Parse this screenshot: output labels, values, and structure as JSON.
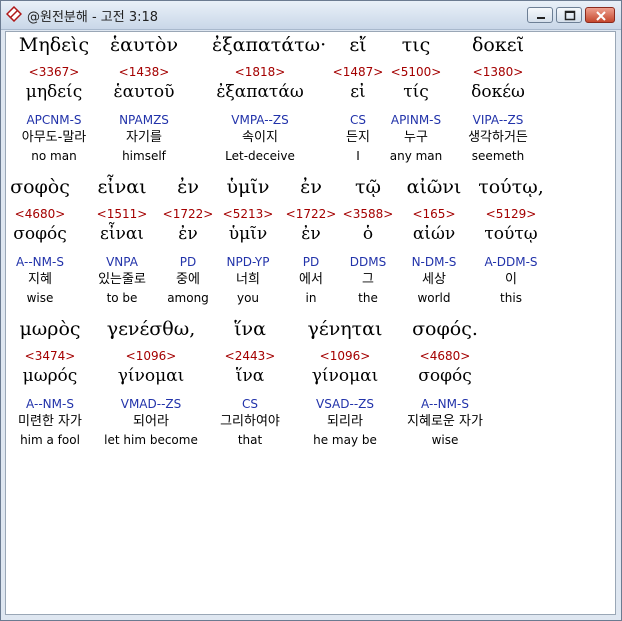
{
  "window": {
    "title": "@원전분해 - 고전 3:18",
    "icon": "app-diamond-icon",
    "buttons": [
      "minimize-icon",
      "maximize-icon",
      "close-icon"
    ],
    "colors": {
      "greek": "#000000",
      "strong": "#a40000",
      "morph": "#2233aa",
      "gloss": "#000000"
    }
  },
  "rows": [
    {
      "words": [
        {
          "greek": "Μηδεὶς",
          "strong": "<3367>",
          "lexeme": "μηδείς",
          "morph": "APCNM-S",
          "korean": "아무도-말라",
          "english": "no man"
        },
        {
          "greek": "ἑαυτὸν",
          "strong": "<1438>",
          "lexeme": "ἑαυτοῦ",
          "morph": "NPAMZS",
          "korean": "자기를",
          "english": "himself"
        },
        {
          "greek": "ἐξαπατάτω·",
          "strong": "<1818>",
          "lexeme": "ἐξαπατάω",
          "morph": "VMPA--ZS",
          "korean": "속이지",
          "english": "Let-deceive"
        },
        {
          "greek": "εἴ",
          "strong": "<1487>",
          "lexeme": "εἰ",
          "morph": "CS",
          "korean": "든지",
          "english": "I"
        },
        {
          "greek": "τις",
          "strong": "<5100>",
          "lexeme": "τίς",
          "morph": "APINM-S",
          "korean": "누구",
          "english": "any man"
        },
        {
          "greek": "δοκεῖ",
          "strong": "<1380>",
          "lexeme": "δοκέω",
          "morph": "VIPA--ZS",
          "korean": "생각하거든",
          "english": "seemeth"
        }
      ]
    },
    {
      "words": [
        {
          "greek": "σοφὸς",
          "strong": "<4680>",
          "lexeme": "σοφός",
          "morph": "A--NM-S",
          "korean": "지혜",
          "english": "wise"
        },
        {
          "greek": "εἶναι",
          "strong": "<1511>",
          "lexeme": "εἶναι",
          "morph": "VNPA",
          "korean": "있는줄로",
          "english": "to be"
        },
        {
          "greek": "ἐν",
          "strong": "<1722>",
          "lexeme": "ἐν",
          "morph": "PD",
          "korean": "중에",
          "english": "among"
        },
        {
          "greek": "ὑμῖν",
          "strong": "<5213>",
          "lexeme": "ὑμῖν",
          "morph": "NPD-YP",
          "korean": "너희",
          "english": "you"
        },
        {
          "greek": "ἐν",
          "strong": "<1722>",
          "lexeme": "ἐν",
          "morph": "PD",
          "korean": "에서",
          "english": "in"
        },
        {
          "greek": "τῷ",
          "strong": "<3588>",
          "lexeme": "ὁ",
          "morph": "DDMS",
          "korean": "그",
          "english": "the"
        },
        {
          "greek": "αἰῶνι",
          "strong": "<165>",
          "lexeme": "αἰών",
          "morph": "N-DM-S",
          "korean": "세상",
          "english": "world"
        },
        {
          "greek": "τούτῳ,",
          "strong": "<5129>",
          "lexeme": "τούτῳ",
          "morph": "A-DDM-S",
          "korean": "이",
          "english": "this"
        }
      ]
    },
    {
      "words": [
        {
          "greek": "μωρὸς",
          "strong": "<3474>",
          "lexeme": "μωρός",
          "morph": "A--NM-S",
          "korean": "미련한 자가",
          "english": "him a fool"
        },
        {
          "greek": "γενέσθω,",
          "strong": "<1096>",
          "lexeme": "γίνομαι",
          "morph": "VMAD--ZS",
          "korean": "되어라",
          "english": "let him become"
        },
        {
          "greek": "ἵνα",
          "strong": "<2443>",
          "lexeme": "ἵνα",
          "morph": "CS",
          "korean": "그리하여야",
          "english": "that"
        },
        {
          "greek": "γένηται",
          "strong": "<1096>",
          "lexeme": "γίνομαι",
          "morph": "VSAD--ZS",
          "korean": "되리라",
          "english": "he may be"
        },
        {
          "greek": "σοφός.",
          "strong": "<4680>",
          "lexeme": "σοφός",
          "morph": "A--NM-S",
          "korean": "지혜로운 자가",
          "english": "wise"
        }
      ]
    }
  ]
}
